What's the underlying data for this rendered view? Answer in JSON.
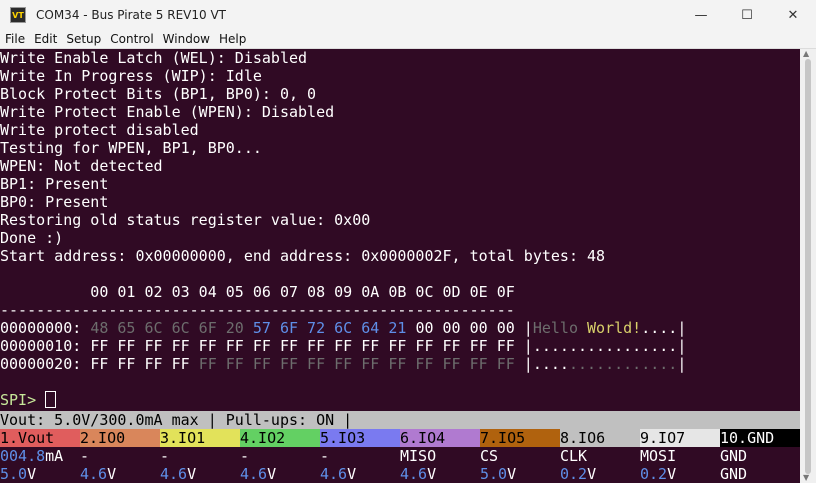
{
  "window": {
    "title": "COM34 - Bus Pirate 5 REV10 VT",
    "icon_label": "VT",
    "minimize": "—",
    "maximize": "☐",
    "close": "✕"
  },
  "menu": [
    "File",
    "Edit",
    "Setup",
    "Control",
    "Window",
    "Help"
  ],
  "terminal": {
    "lines": [
      "Write Enable Latch (WEL): Disabled",
      "Write In Progress (WIP): Idle",
      "Block Protect Bits (BP1, BP0): 0, 0",
      "Write Protect Enable (WPEN): Disabled",
      "Write protect disabled",
      "Testing for WPEN, BP1, BP0...",
      "WPEN: Not detected",
      "BP1: Present",
      "BP0: Present",
      "Restoring old status register value: 0x00",
      "Done :)",
      "Start address: 0x00000000, end address: 0x0000002F, total bytes: 48"
    ],
    "hex_header": "          00 01 02 03 04 05 06 07 08 09 0A 0B 0C 0D 0E 0F",
    "hex_divider": "---------------------------------------------------------",
    "hex_rows": [
      {
        "addr": "00000000:",
        "dim_bytes": "48 65 6C 6C 6F 20",
        "blue_bytes": "57 6F 72 6C 64 21",
        "white_bytes": "00 00 00 00",
        "ascii_dim": "Hello",
        "ascii_yel": "World!",
        "ascii_rest": "...."
      },
      {
        "addr": "00000010:",
        "bytes": "FF FF FF FF FF FF FF FF FF FF FF FF FF FF FF FF",
        "ascii": "................"
      },
      {
        "addr": "00000020:",
        "bytes_white": "FF FF FF FF",
        "bytes_dim": "FF FF FF FF FF FF FF FF FF FF FF FF",
        "ascii_white": "....",
        "ascii_dim": "............"
      }
    ],
    "prompt": "SPI>"
  },
  "status": {
    "text": "Vout: 5.0V/300.0mA max | Pull-ups: ON |",
    "pins": [
      {
        "label": "1.Vout",
        "bg": "#e05d5d"
      },
      {
        "label": "2.IO0",
        "bg": "#d9865b"
      },
      {
        "label": "3.IO1",
        "bg": "#e2e25a"
      },
      {
        "label": "4.IO2",
        "bg": "#63d063"
      },
      {
        "label": "5.IO3",
        "bg": "#7a7af0"
      },
      {
        "label": "6.IO4",
        "bg": "#b07ad0"
      },
      {
        "label": "7.IO5",
        "bg": "#b0620e"
      },
      {
        "label": "8.IO6",
        "bg": "#c0c0c0"
      },
      {
        "label": "9.IO7",
        "bg": "#e6e6e6"
      },
      {
        "label": "10.GND",
        "bg": "#000000",
        "fg": "#ffffff"
      }
    ],
    "functions": [
      {
        "num": "004.8",
        "unit": "mA"
      },
      {
        "text": "-"
      },
      {
        "text": "-"
      },
      {
        "text": "-"
      },
      {
        "text": "-"
      },
      {
        "text": "MISO"
      },
      {
        "text": "CS"
      },
      {
        "text": "CLK"
      },
      {
        "text": "MOSI"
      },
      {
        "text": "GND"
      }
    ],
    "voltages": [
      {
        "num": "5.0",
        "unit": "V"
      },
      {
        "num": "4.6",
        "unit": "V"
      },
      {
        "num": "4.6",
        "unit": "V"
      },
      {
        "num": "4.6",
        "unit": "V"
      },
      {
        "num": "4.6",
        "unit": "V"
      },
      {
        "num": "4.6",
        "unit": "V"
      },
      {
        "num": "5.0",
        "unit": "V"
      },
      {
        "num": "0.2",
        "unit": "V"
      },
      {
        "num": "0.2",
        "unit": "V"
      },
      {
        "text": "GND"
      }
    ]
  }
}
